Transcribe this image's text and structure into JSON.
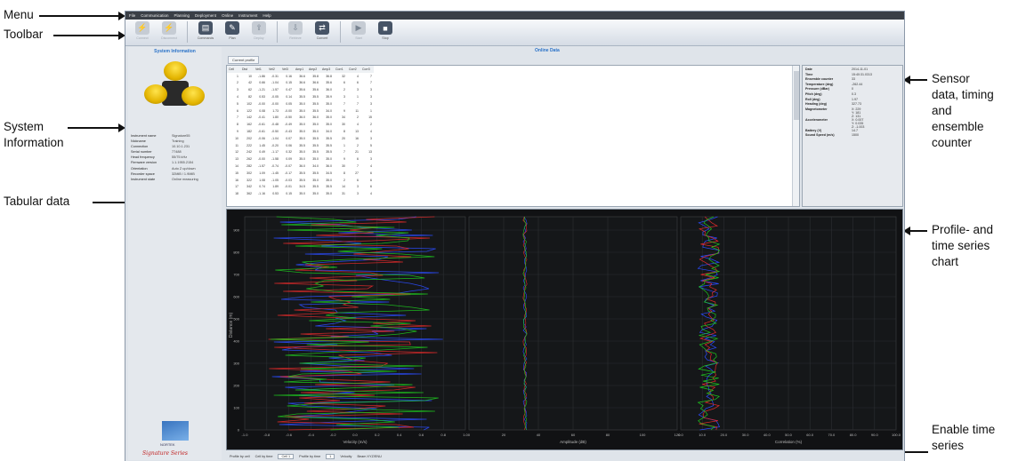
{
  "annotations": {
    "menu": "Menu",
    "toolbar": "Toolbar",
    "system_information": "System\nInformation",
    "tabular_data": "Tabular data",
    "sensor_data": "Sensor\ndata, timing\nand\nensemble\ncounter",
    "profile_chart": "Profile- and\ntime series\nchart",
    "enable_time_series": "Enable time\nseries"
  },
  "menu": [
    "File",
    "Communication",
    "Planning",
    "Deployment",
    "Online",
    "Instrument",
    "Help"
  ],
  "toolbar": [
    {
      "label": "Connect",
      "enabled": false,
      "icon": "plug-icon"
    },
    {
      "label": "Disconnect",
      "enabled": false,
      "icon": "unplug-icon"
    },
    {
      "label": "Commands",
      "enabled": true,
      "icon": "terminal-icon"
    },
    {
      "label": "Plan",
      "enabled": true,
      "icon": "plan-icon"
    },
    {
      "label": "Deploy",
      "enabled": false,
      "icon": "deploy-icon"
    },
    {
      "label": "Retrieve",
      "enabled": false,
      "icon": "retrieve-icon"
    },
    {
      "label": "Convert",
      "enabled": true,
      "icon": "convert-icon"
    },
    {
      "label": "Start",
      "enabled": false,
      "icon": "play-icon"
    },
    {
      "label": "Stop",
      "enabled": true,
      "icon": "stop-icon"
    }
  ],
  "system_info": {
    "header": "System Information",
    "rows": [
      {
        "k": "Instrument name",
        "v": "Signature55"
      },
      {
        "k": "Nickname",
        "v": "Training"
      },
      {
        "k": "Connection",
        "v": "10.10.1.231"
      },
      {
        "k": "Serial number",
        "v": "77488"
      },
      {
        "k": "Head frequency",
        "v": "55/75 kHz"
      },
      {
        "k": "Firmware version",
        "v": "1.1.1955.2154"
      },
      {
        "k": "Orientation",
        "v": "Auto Z up/down"
      },
      {
        "k": "Recorder space",
        "v": "32MiB / 1.9MiB"
      },
      {
        "k": "Instrument state",
        "v": "Online measuring"
      }
    ],
    "brand": "NORTEK",
    "series": "Signature Series"
  },
  "online": {
    "header": "Online Data",
    "tab": "Current profile",
    "columns": [
      "Cell",
      "Dist",
      "Vel1",
      "Vel2",
      "Vel3",
      "Amp1",
      "Amp2",
      "Amp3",
      "Corr1",
      "Corr2",
      "Corr3"
    ],
    "rows": [
      [
        "1",
        "10",
        "-1.86",
        "-0.31",
        "0.16",
        "36.6",
        "35.8",
        "36.8",
        "32",
        "4",
        "7"
      ],
      [
        "2",
        "42",
        "0.66",
        "-1.04",
        "0.15",
        "36.6",
        "36.6",
        "35.6",
        "6",
        "6",
        "7"
      ],
      [
        "3",
        "62",
        "-1.21",
        "-1.57",
        "0.47",
        "35.6",
        "35.6",
        "36.0",
        "2",
        "3",
        "3"
      ],
      [
        "4",
        "82",
        "0.53",
        "-0.05",
        "0.14",
        "35.5",
        "35.5",
        "35.9",
        "3",
        "1",
        "3"
      ],
      [
        "5",
        "102",
        "-0.00",
        "-0.00",
        "0.05",
        "35.0",
        "35.5",
        "35.0",
        "7",
        "7",
        "3"
      ],
      [
        "6",
        "122",
        "0.08",
        "1.73",
        "-0.00",
        "35.0",
        "35.5",
        "34.0",
        "9",
        "11",
        "1"
      ],
      [
        "7",
        "142",
        "-0.41",
        "1.80",
        "-0.50",
        "36.0",
        "36.0",
        "35.0",
        "34",
        "2",
        "15"
      ],
      [
        "8",
        "162",
        "-0.61",
        "-0.48",
        "-0.49",
        "35.0",
        "35.0",
        "35.0",
        "30",
        "4",
        "2"
      ],
      [
        "9",
        "182",
        "-0.61",
        "-0.50",
        "-0.43",
        "35.0",
        "35.0",
        "34.0",
        "8",
        "13",
        "4"
      ],
      [
        "10",
        "202",
        "-0.06",
        "-1.04",
        "0.07",
        "35.0",
        "35.5",
        "35.5",
        "20",
        "16",
        "3"
      ],
      [
        "11",
        "222",
        "1.45",
        "-0.20",
        "0.06",
        "35.5",
        "35.5",
        "35.5",
        "1",
        "2",
        "5"
      ],
      [
        "12",
        "242",
        "0.49",
        "-1.17",
        "0.32",
        "35.0",
        "35.5",
        "35.5",
        "7",
        "21",
        "13"
      ],
      [
        "13",
        "262",
        "-0.00",
        "-1.58",
        "0.09",
        "35.0",
        "35.0",
        "35.0",
        "9",
        "6",
        "3"
      ],
      [
        "14",
        "282",
        "-1.57",
        "-0.74",
        "-0.07",
        "36.0",
        "34.0",
        "36.0",
        "30",
        "7",
        "4"
      ],
      [
        "15",
        "302",
        "1.09",
        "-1.45",
        "-0.17",
        "35.5",
        "35.5",
        "34.5",
        "8",
        "27",
        "6"
      ],
      [
        "16",
        "322",
        "1.08",
        "-1.05",
        "-0.03",
        "35.5",
        "35.0",
        "35.0",
        "2",
        "6",
        "6"
      ],
      [
        "17",
        "342",
        "0.74",
        "1.89",
        "-0.01",
        "34.5",
        "35.5",
        "35.5",
        "14",
        "3",
        "6"
      ],
      [
        "18",
        "362",
        "-1.16",
        "0.53",
        "0.15",
        "35.0",
        "35.0",
        "35.0",
        "31",
        "3",
        "4"
      ]
    ]
  },
  "sensor": [
    {
      "k": "Date",
      "v": "2014-11-01"
    },
    {
      "k": "Time",
      "v": "15:40:31.0313"
    },
    {
      "k": "Ensemble counter",
      "v": "33"
    },
    {
      "k": "Temperature (deg)",
      "v": "-262.44"
    },
    {
      "k": "Pressure (dBar)",
      "v": "0"
    },
    {
      "k": "Pitch (deg)",
      "v": "0.3"
    },
    {
      "k": "Roll (deg)",
      "v": "1.97"
    },
    {
      "k": "Heading (deg)",
      "v": "327.73"
    },
    {
      "k": "Magnetometer",
      "v": "X: 229\nY: 181\nZ: 131"
    },
    {
      "k": "Accelerometer",
      "v": "X: 0.007\nY: 0.035\nZ: -1.003"
    },
    {
      "k": "Battery (V)",
      "v": "14.7"
    },
    {
      "k": "Sound Speed (m/s)",
      "v": "1500"
    }
  ],
  "chart": {
    "ylabel": "Distance (m)",
    "yticks": [
      "0",
      "100",
      "200",
      "300",
      "400",
      "500",
      "600",
      "700",
      "800",
      "900"
    ],
    "panels": [
      {
        "xlabel": "Velocity (m/s)",
        "xticks": [
          "-1.0",
          "-0.8",
          "-0.6",
          "-0.4",
          "-0.2",
          "0.0",
          "0.2",
          "0.4",
          "0.6",
          "0.8",
          "1.0"
        ]
      },
      {
        "xlabel": "Amplitude (dB)",
        "xticks": [
          "0",
          "20",
          "40",
          "60",
          "80",
          "100",
          "120"
        ]
      },
      {
        "xlabel": "Correlation (%)",
        "xticks": [
          "0.0",
          "10.0",
          "20.0",
          "30.0",
          "40.0",
          "50.0",
          "60.0",
          "70.0",
          "80.0",
          "90.0",
          "100.0"
        ]
      }
    ],
    "colors": {
      "beam1": "#2b4cff",
      "beam2": "#e02a2a",
      "beam3": "#1ec41e"
    }
  },
  "bottombar": {
    "profile_by_cell": "Profile by cell",
    "cell_by_time": "Cell by time",
    "cell_value": "Cell 1",
    "profile_by_time": "Profile by time",
    "profile_value": "1",
    "velocity": "Velocity",
    "beam": "Beam XYZ/ENU"
  }
}
